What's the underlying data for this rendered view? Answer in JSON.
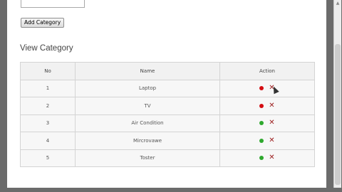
{
  "form": {
    "add_button_label": "Add Category"
  },
  "section": {
    "title": "View Category"
  },
  "table": {
    "headers": {
      "no": "No",
      "name": "Name",
      "action": "Action"
    },
    "rows": [
      {
        "no": "1",
        "name": "Laptop",
        "status_color": "#d40d12"
      },
      {
        "no": "2",
        "name": "TV",
        "status_color": "#d40d12"
      },
      {
        "no": "3",
        "name": "Air Condition",
        "status_color": "#2ea82e"
      },
      {
        "no": "4",
        "name": "Mircrovawe",
        "status_color": "#2ea82e"
      },
      {
        "no": "5",
        "name": "Toster",
        "status_color": "#2ea82e"
      }
    ]
  },
  "icons": {
    "status": "status-dot-icon",
    "delete": "delete-x-icon",
    "delete_glyph": "✕"
  }
}
